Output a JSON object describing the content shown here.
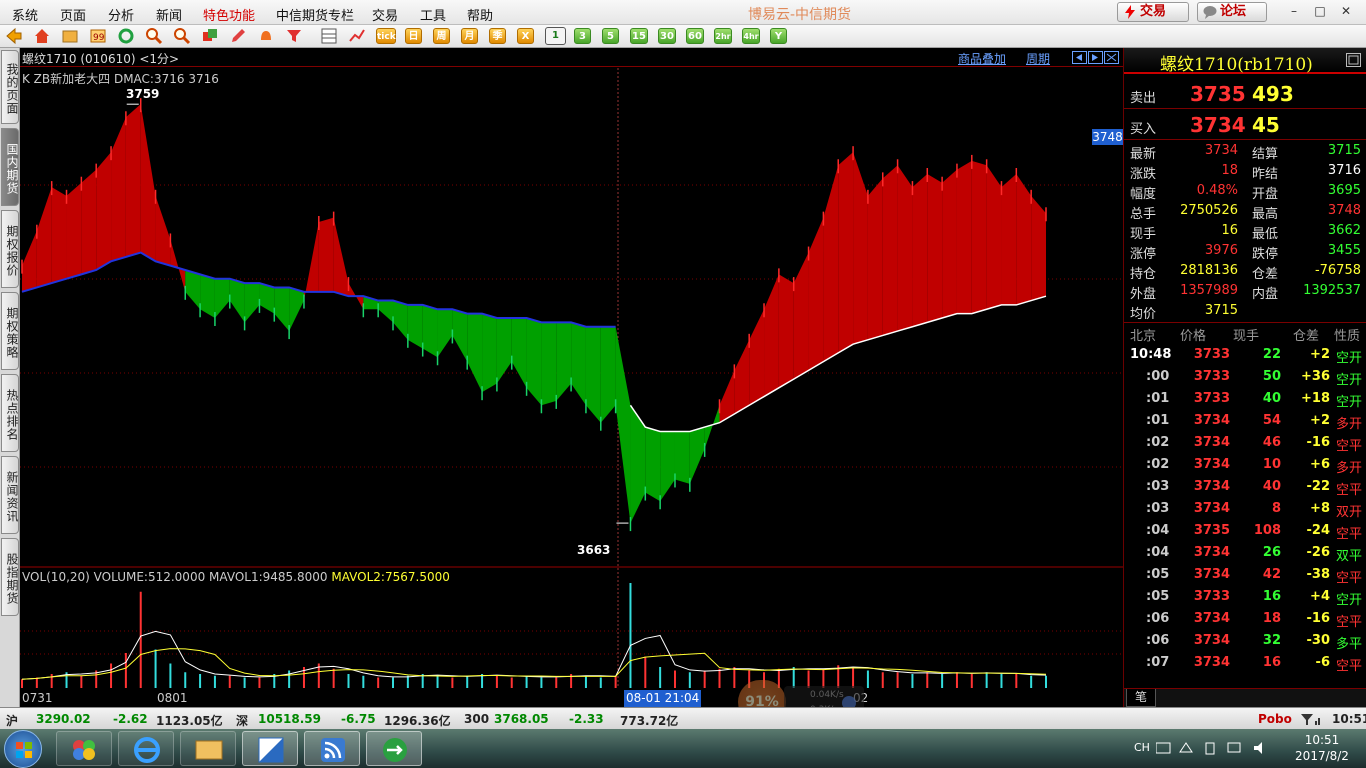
{
  "menubar": {
    "items": [
      {
        "label": "系统",
        "hl": false
      },
      {
        "label": "页面",
        "hl": false
      },
      {
        "label": "分析",
        "hl": false
      },
      {
        "label": "新闻",
        "hl": false
      },
      {
        "label": "特色功能",
        "hl": true
      },
      {
        "label": "中信期货专栏",
        "hl": false
      },
      {
        "label": "交易",
        "hl": false
      },
      {
        "label": "工具",
        "hl": false
      },
      {
        "label": "帮助",
        "hl": false
      }
    ],
    "app_title": "博易云-中信期货",
    "trade_button": "交易",
    "forum_button": "论坛",
    "min_symbol": "–",
    "max_symbol": "□",
    "close_symbol": "✕"
  },
  "toolbar": {
    "label_tick": "tick",
    "label_day": "日",
    "label_week": "周",
    "label_month": "月",
    "label_season": "季",
    "label_x": "X",
    "periods": [
      "1",
      "3",
      "5",
      "15",
      "30",
      "60",
      "2hr",
      "4hr",
      "Y"
    ]
  },
  "lefttabs": [
    "我的页面",
    "国内期货",
    "期权报价",
    "期权策略",
    "热点排名",
    "新闻资讯",
    "股指期货"
  ],
  "chart_header": {
    "indicator": "K  ZB新加老大四  DMAC:3716  3716",
    "title": "螺纹1710 (010610) <1分>",
    "overlay_link": "商品叠加",
    "period_link": "周期",
    "high_label": "3759",
    "low_label": "3663",
    "price_flag": "3748"
  },
  "volume_header": {
    "prefix": "VOL(10,20) VOLUME:512.0000 MAVOL1:9485.8000",
    "mavol2": "MAVOL2:7567.5000"
  },
  "xaxis": {
    "labels": [
      "0731",
      "0801",
      "02"
    ],
    "cursor_time": "08-01 21:04"
  },
  "net": {
    "percent": "91%",
    "up": "0.04K/s",
    "down": "0.3K/s"
  },
  "quote": {
    "title": "螺纹1710(rb1710)",
    "sell_label": "卖出",
    "sell_price": "3735",
    "sell_vol": "493",
    "buy_label": "买入",
    "buy_price": "3734",
    "buy_vol": "45",
    "rows": [
      {
        "l1": "最新",
        "v1": "3734",
        "c1": "#ff3333",
        "l2": "结算",
        "v2": "3715",
        "c2": "#33ff33"
      },
      {
        "l1": "涨跌",
        "v1": "18",
        "c1": "#ff3333",
        "l2": "昨结",
        "v2": "3716",
        "c2": "#ffffff"
      },
      {
        "l1": "幅度",
        "v1": "0.48%",
        "c1": "#ff3333",
        "l2": "开盘",
        "v2": "3695",
        "c2": "#33ff33"
      },
      {
        "l1": "总手",
        "v1": "2750526",
        "c1": "#ffff33",
        "l2": "最高",
        "v2": "3748",
        "c2": "#ff3333"
      },
      {
        "l1": "现手",
        "v1": "16",
        "c1": "#ffff33",
        "l2": "最低",
        "v2": "3662",
        "c2": "#33ff33"
      },
      {
        "l1": "涨停",
        "v1": "3976",
        "c1": "#ff3333",
        "l2": "跌停",
        "v2": "3455",
        "c2": "#33ff33"
      },
      {
        "l1": "持仓",
        "v1": "2818136",
        "c1": "#ffff33",
        "l2": "仓差",
        "v2": "-76758",
        "c2": "#ffff33"
      },
      {
        "l1": "外盘",
        "v1": "1357989",
        "c1": "#ff3333",
        "l2": "内盘",
        "v2": "1392537",
        "c2": "#33ff33"
      },
      {
        "l1": "均价",
        "v1": "3715",
        "c1": "#ffff33",
        "l2": "",
        "v2": "",
        "c2": "#ffffff"
      }
    ]
  },
  "ticks": {
    "headers": [
      "北京",
      "价格",
      "现手",
      "仓差",
      "性质"
    ],
    "rows": [
      {
        "time": "10:48",
        "price": "3733",
        "pc": "#ff3333",
        "vol": "22",
        "vc": "#33ff33",
        "oi": "+2",
        "nature": "空开",
        "nc": "#33ff33",
        "bold_time": true
      },
      {
        "time": ":00",
        "price": "3733",
        "pc": "#ff3333",
        "vol": "50",
        "vc": "#33ff33",
        "oi": "+36",
        "nature": "空开",
        "nc": "#33ff33"
      },
      {
        "time": ":01",
        "price": "3733",
        "pc": "#ff3333",
        "vol": "40",
        "vc": "#33ff33",
        "oi": "+18",
        "nature": "空开",
        "nc": "#33ff33"
      },
      {
        "time": ":01",
        "price": "3734",
        "pc": "#ff3333",
        "vol": "54",
        "vc": "#ff3333",
        "oi": "+2",
        "nature": "多开",
        "nc": "#ff3333"
      },
      {
        "time": ":02",
        "price": "3734",
        "pc": "#ff3333",
        "vol": "46",
        "vc": "#ff3333",
        "oi": "-16",
        "nature": "空平",
        "nc": "#ff3333"
      },
      {
        "time": ":02",
        "price": "3734",
        "pc": "#ff3333",
        "vol": "10",
        "vc": "#ff3333",
        "oi": "+6",
        "nature": "多开",
        "nc": "#ff3333"
      },
      {
        "time": ":03",
        "price": "3734",
        "pc": "#ff3333",
        "vol": "40",
        "vc": "#ff3333",
        "oi": "-22",
        "nature": "空平",
        "nc": "#ff3333"
      },
      {
        "time": ":03",
        "price": "3734",
        "pc": "#ff3333",
        "vol": "8",
        "vc": "#ff3333",
        "oi": "+8",
        "nature": "双开",
        "nc": "#ff3333"
      },
      {
        "time": ":04",
        "price": "3735",
        "pc": "#ff3333",
        "vol": "108",
        "vc": "#ff3333",
        "oi": "-24",
        "nature": "空平",
        "nc": "#ff3333"
      },
      {
        "time": ":04",
        "price": "3734",
        "pc": "#ff3333",
        "vol": "26",
        "vc": "#33ff33",
        "oi": "-26",
        "nature": "双平",
        "nc": "#33ff33"
      },
      {
        "time": ":05",
        "price": "3734",
        "pc": "#ff3333",
        "vol": "42",
        "vc": "#ff3333",
        "oi": "-38",
        "nature": "空平",
        "nc": "#ff3333"
      },
      {
        "time": ":05",
        "price": "3733",
        "pc": "#ff3333",
        "vol": "16",
        "vc": "#33ff33",
        "oi": "+4",
        "nature": "空开",
        "nc": "#33ff33"
      },
      {
        "time": ":06",
        "price": "3734",
        "pc": "#ff3333",
        "vol": "18",
        "vc": "#ff3333",
        "oi": "-16",
        "nature": "空平",
        "nc": "#ff3333"
      },
      {
        "time": ":06",
        "price": "3734",
        "pc": "#ff3333",
        "vol": "32",
        "vc": "#33ff33",
        "oi": "-30",
        "nature": "多平",
        "nc": "#33ff33"
      },
      {
        "time": ":07",
        "price": "3734",
        "pc": "#ff3333",
        "vol": "16",
        "vc": "#ff3333",
        "oi": "-6",
        "nature": "空平",
        "nc": "#ff3333"
      }
    ],
    "tab_label": "笔"
  },
  "statusbar": {
    "sh_label": "沪",
    "sh_index": "3290.02",
    "sh_chg": "-2.62",
    "sh_amt": "1123.05亿",
    "sz_label": "深",
    "sz_index": "10518.59",
    "sz_chg": "-6.75",
    "sz_amt": "1296.36亿",
    "hs_label": "300",
    "hs_index": "3768.05",
    "hs_chg": "-2.33",
    "hs_amt": "773.72亿",
    "brand": "Pobo",
    "time": "10:51"
  },
  "taskbar": {
    "lang": "CH",
    "clock_time": "10:51",
    "clock_date": "2017/8/2"
  },
  "colors": {
    "up": "#ff3333",
    "down": "#33ff33",
    "bull_fill": "#c00000",
    "bear_fill": "#00a000",
    "avg_line": "#ffffff",
    "ma_blue": "#2233dd"
  },
  "chart_data": {
    "type": "line",
    "series": [
      {
        "name": "price",
        "values": [
          3722,
          3730,
          3740,
          3738,
          3741,
          3744,
          3748,
          3756,
          3759,
          3738,
          3728,
          3716,
          3712,
          3710,
          3714,
          3709,
          3713,
          3711,
          3707,
          3714,
          3732,
          3733,
          3718,
          3712,
          3712,
          3709,
          3705,
          3703,
          3701,
          3706,
          3700,
          3693,
          3695,
          3700,
          3694,
          3690,
          3691,
          3695,
          3690,
          3686,
          3690,
          3663,
          3670,
          3668,
          3673,
          3672,
          3680,
          3690,
          3698,
          3705,
          3712,
          3720,
          3718,
          3725,
          3733,
          3745,
          3748,
          3738,
          3742,
          3745,
          3740,
          3743,
          3741,
          3744,
          3746,
          3745,
          3740,
          3743,
          3738,
          3734
        ]
      },
      {
        "name": "avg",
        "values": [
          3716,
          3717,
          3718,
          3719,
          3720,
          3721,
          3723,
          3724,
          3725,
          3723,
          3722,
          3721,
          3720,
          3719,
          3719,
          3718,
          3718,
          3717,
          3717,
          3716,
          3716,
          3716,
          3715,
          3715,
          3714,
          3714,
          3713,
          3713,
          3712,
          3712,
          3711,
          3711,
          3710,
          3710,
          3710,
          3709,
          3709,
          3709,
          3708,
          3708,
          3708,
          3690,
          3685,
          3684,
          3684,
          3684,
          3685,
          3686,
          3688,
          3690,
          3692,
          3694,
          3696,
          3698,
          3700,
          3702,
          3704,
          3705,
          3706,
          3707,
          3708,
          3709,
          3710,
          3711,
          3711,
          3712,
          3713,
          3713,
          3714,
          3715
        ]
      },
      {
        "name": "volume",
        "values": [
          5,
          6,
          8,
          9,
          7,
          10,
          14,
          20,
          55,
          22,
          14,
          9,
          8,
          7,
          7,
          6,
          6,
          8,
          10,
          12,
          14,
          11,
          8,
          7,
          6,
          6,
          7,
          8,
          7,
          6,
          7,
          8,
          7,
          6,
          7,
          6,
          6,
          8,
          7,
          6,
          7,
          60,
          18,
          12,
          10,
          9,
          10,
          11,
          12,
          10,
          9,
          11,
          12,
          10,
          11,
          13,
          12,
          10,
          9,
          9,
          8,
          9,
          8,
          9,
          8,
          9,
          8,
          8,
          7,
          7
        ]
      }
    ],
    "high": 3759,
    "low": 3663,
    "ylim": [
      3655,
      3765
    ]
  }
}
